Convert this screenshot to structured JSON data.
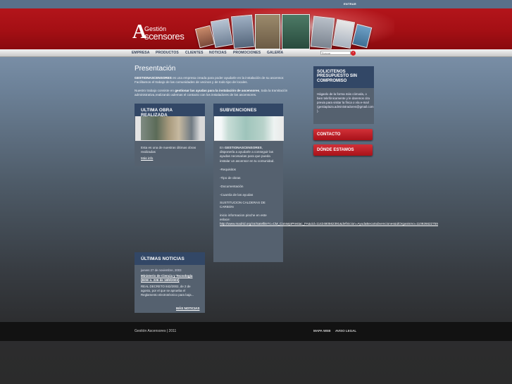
{
  "topbar": {
    "entrar_label": "ENTRAR"
  },
  "logo": {
    "initial": "A",
    "line1": "Gestión",
    "line2": "scensores"
  },
  "nav": {
    "items": [
      "EMPRESA",
      "PRODUCTOS",
      "CLIENTES",
      "NOTICIAS",
      "PROMOCIONES",
      "GALERÍA"
    ],
    "search_placeholder": "Buscar"
  },
  "main": {
    "title": "Presentación",
    "intro_p1_bold": "GESTIONASCENSORES",
    "intro_p1_rest": " es una empresa creada para poder ayudarle en la instalación de su ascensor. Facilitamos el trabajo de las comunidades de vecinos y de todo tipo de locales.",
    "intro_p2_start": "Nuestro trabajo consiste en ",
    "intro_p2_bold": "gestionar las ayudas para la instalación de ascensores",
    "intro_p2_rest": ", toda la tramitación administrativa,realizando ademas el contacto con los instaladores de los ascensores."
  },
  "obra": {
    "title": "ULTIMA OBRA REALIZADA",
    "text": "Esta es una de nuestras últimas obras realizadas",
    "link": "Más info"
  },
  "subv": {
    "title": "SUBVENCIONES",
    "p1_start": "En ",
    "p1_bold": "GESTIONASCENSORES",
    "p1_rest": ", disponerla a ayudarle a conseguir las ayudas necesarias para que pueda instalar un ascensor en tu comunidad.",
    "items": [
      "-Requisitos",
      "-Tipo de obras",
      "-Documentación",
      "-Cuantía de las ayudas"
    ],
    "sustitucion": "SUSTITUCION CALDERAS DE CARBON",
    "info": "inicio informacion pinche en este enlace:",
    "url": "http://www.madrid.org/cs/Satellite?c=CM_ConsejoPrestac_FA&cid=1142480562391&definicion=AyudaBecaSubvenciones&idOrganismo=1109266227594&language=es&pagename=ComunidadMadrid%2FEstru"
  },
  "news": {
    "title": "ÚLTIMAS NOTICIAS",
    "date": "jueves 27 de noviembre, 2003",
    "headline": "Ministerio de Ciencia y Tecnología (BOE n. 226 de 18/9/2003)",
    "text": "REAL DECRETO 842/2002, de 2 de agosto, por el que se aprueba el Reglamento electrotécnico para baja...",
    "more": "MÁS NOTICIAS"
  },
  "presupuesto": {
    "title": "SOLICITENOS PRESUPUESTO SIN COMPROMISO",
    "text": "Háganlo de la forma más cómoda, o bien telefónicamente y le daremos cita previa para visitar la finca o vía e-mail",
    "email": "(gestiaplaza.administradores@gmail.com",
    "closing": ")."
  },
  "buttons": {
    "contacto": "CONTACTO",
    "donde": "DÓNDE ESTAMOS"
  },
  "footer": {
    "copyright": "Gestión Ascensores | 2011",
    "mapa": "MAPA WEB",
    "aviso": "AVISO LEGAL"
  }
}
